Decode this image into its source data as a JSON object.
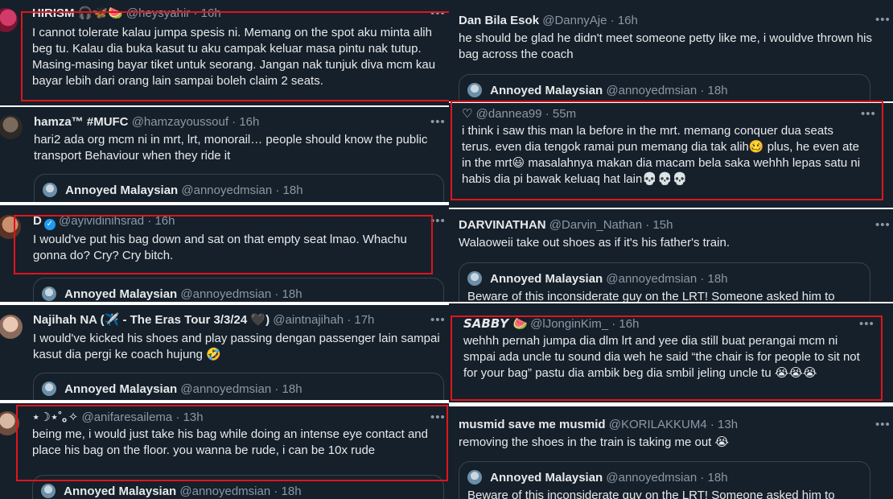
{
  "left": [
    {
      "name": "HIRISM 🎧🦋🍉",
      "meta": "@heysyahir · 16h",
      "verified": false,
      "text": "I cannot tolerate kalau jumpa spesis ni. Memang on the spot aku minta alih beg tu. Kalau dia buka kasut tu aku campak keluar masa pintu nak tutup. Masing-masing bayar tiket untuk seorang. Jangan nak tunjuk diva mcm kau bayar lebih dari orang lain sampai boleh claim 2 seats.",
      "quote": null
    },
    {
      "name": "hamza™ #MUFC",
      "meta": "@hamzayoussouf · 16h",
      "verified": false,
      "text": "hari2 ada org mcm ni in mrt, lrt, monorail… people should know the public transport Behaviour when they ride it",
      "quote": {
        "name": "Annoyed Malaysian",
        "meta": "@annoyedmsian · 18h",
        "text": ""
      }
    },
    {
      "name": "D",
      "meta": "@ayividinihsrad · 16h",
      "verified": true,
      "text": "I would've put his bag down and sat on that empty seat lmao. Whachu gonna do? Cry? Cry bitch.",
      "quote": {
        "name": "Annoyed Malaysian",
        "meta": "@annoyedmsian · 18h",
        "text": ""
      }
    },
    {
      "name": "Najihah NA (✈️ - The Eras Tour 3/3/24 🖤)",
      "meta": "@aintnajihah · 17h",
      "verified": false,
      "text": "I would've kicked his shoes and play passing dengan passenger lain sampai kasut dia pergi ke coach hujung 🤣",
      "quote": {
        "name": "Annoyed Malaysian",
        "meta": "@annoyedmsian · 18h",
        "text": ""
      }
    },
    {
      "name": "⋆☽⋆˚｡✧",
      "meta": "@anifaresailema · 13h",
      "verified": false,
      "text": "being me, i would just take his bag while doing an intense eye contact and place his bag on the floor. you wanna be rude, i can be 10x rude",
      "quote": {
        "name": "Annoyed Malaysian",
        "meta": "@annoyedmsian · 18h",
        "text": ""
      }
    }
  ],
  "right": [
    {
      "name": "Dan Bila Esok",
      "meta": "@DannyAje · 16h",
      "verified": false,
      "text": "he should be glad he didn't meet someone petty like me, i wouldve thrown his bag across the coach",
      "quote": {
        "name": "Annoyed Malaysian",
        "meta": "@annoyedmsian · 18h",
        "text": ""
      }
    },
    {
      "name": "♡",
      "meta": "@dannea99 · 55m",
      "verified": false,
      "text": "i think i saw this man la before in the mrt. memang conquer dua seats terus. even dia tengok ramai pun memang dia tak alih🥴 plus, he even ate in the mrt😃 masalahnya makan dia macam bela saka wehhh lepas satu ni habis dia pi bawak keluaq hat lain💀💀💀",
      "quote": null
    },
    {
      "name": "DARVINATHAN",
      "meta": "@Darvin_Nathan · 15h",
      "verified": false,
      "text": "Walaoweii take out shoes as if it's his father's train.",
      "quote": {
        "name": "Annoyed Malaysian",
        "meta": "@annoyedmsian · 18h",
        "text": "Beware of this inconsiderate guy on the LRT! Someone asked him to"
      }
    },
    {
      "name": "𝙎𝘼𝘽𝘽𝙔 🍉",
      "meta": "@lJonginKim_ · 16h",
      "verified": false,
      "text": "wehhh pernah jumpa dia dlm lrt and yee dia still buat perangai mcm ni smpai ada uncle tu sound dia weh he said “the chair is for people to sit not for your bag” pastu dia ambik beg dia smbil jeling uncle tu 😭😭😭",
      "quote": null
    },
    {
      "name": "musmid save me musmid",
      "meta": "@KORILAKKUM4 · 13h",
      "verified": false,
      "text": "removing the shoes in the train is taking me out 😭",
      "quote": {
        "name": "Annoyed Malaysian",
        "meta": "@annoyedmsian · 18h",
        "text": "Beware of this inconsiderate guy on the LRT! Someone asked him to"
      }
    }
  ],
  "more_label": "•••",
  "colors": {
    "background": "#15202b",
    "text": "#e7e9ea",
    "muted": "#8b98a5",
    "highlight": "#e1141b",
    "border": "#38444d"
  }
}
